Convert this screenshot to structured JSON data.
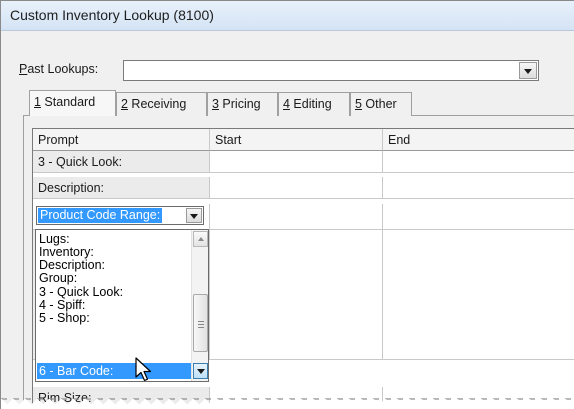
{
  "window": {
    "title": "Custom Inventory Lookup (8100)"
  },
  "past_lookups": {
    "label_prefix": "P",
    "label_rest": "ast Lookups:",
    "value": ""
  },
  "tabs": [
    {
      "key": "1",
      "label": " Standard",
      "active": true
    },
    {
      "key": "2",
      "label": " Receiving",
      "active": false
    },
    {
      "key": "3",
      "label": " Pricing",
      "active": false
    },
    {
      "key": "4",
      "label": " Editing",
      "active": false
    },
    {
      "key": "5",
      "label": " Other",
      "active": false
    }
  ],
  "grid": {
    "columns": [
      "Prompt",
      "Start",
      "End"
    ],
    "rows": [
      {
        "prompt": "3 - Quick Look:",
        "start": "",
        "end": ""
      },
      {
        "prompt": "Description:",
        "start": "",
        "end": ""
      },
      {
        "prompt": "Product Code Range:",
        "start": "",
        "end": "",
        "editing": true
      },
      {
        "prompt": "",
        "start": "",
        "end": ""
      },
      {
        "prompt": "",
        "start": "",
        "end": ""
      },
      {
        "prompt": "",
        "start": "",
        "end": ""
      },
      {
        "prompt": "",
        "start": "",
        "end": ""
      },
      {
        "prompt": "",
        "start": "",
        "end": ""
      },
      {
        "prompt": "",
        "start": "",
        "end": ""
      },
      {
        "prompt": "",
        "start": "",
        "end": ""
      },
      {
        "prompt": "Rim Size:",
        "start": "",
        "end": ""
      }
    ]
  },
  "dropdown": {
    "items": [
      "Lugs:",
      "Inventory:",
      "Description:",
      "Group:",
      "3 - Quick Look:",
      "4 - Spiff:",
      "5 - Shop:",
      "6 - Bar Code:"
    ],
    "selected_index": 7
  }
}
